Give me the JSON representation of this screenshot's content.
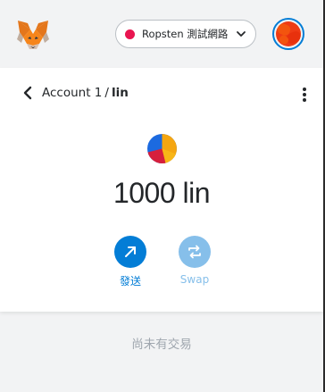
{
  "header": {
    "logo_icon": "metamask-fox-icon",
    "network": {
      "label": "Ropsten 測試網路",
      "dot_color": "#e91550",
      "chevron_icon": "chevron-down-icon"
    },
    "account_avatar_icon": "account-identicon"
  },
  "asset": {
    "back_icon": "chevron-left-icon",
    "breadcrumb_account": "Account 1",
    "breadcrumb_separator": "/",
    "breadcrumb_token": "lin",
    "menu_icon": "kebab-menu-icon",
    "token_icon": "token-identicon",
    "balance": "1000 lin",
    "actions": [
      {
        "label": "發送",
        "icon": "arrow-up-right-icon",
        "color": "#037dd6",
        "enabled": true
      },
      {
        "label": "Swap",
        "icon": "swap-arrows-icon",
        "color": "#86bfea",
        "enabled": false
      }
    ]
  },
  "activity": {
    "empty_text": "尚未有交易"
  },
  "colors": {
    "primary": "#037dd6",
    "background": "#f2f3f4",
    "text": "#24272a",
    "muted": "#9fa6ae"
  }
}
